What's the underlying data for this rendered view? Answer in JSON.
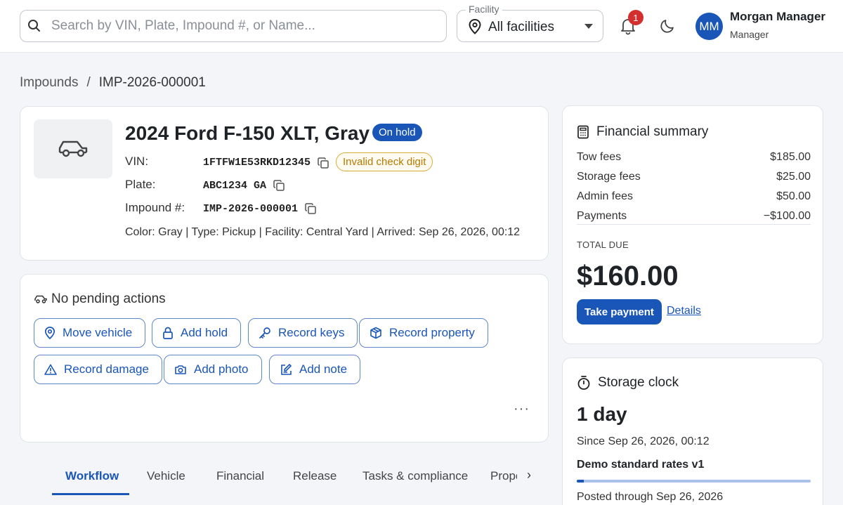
{
  "search": {
    "placeholder": "Search by VIN, Plate, Impound #, or Name..."
  },
  "facility": {
    "label": "Facility",
    "value": "All facilities"
  },
  "notifications": {
    "count": "1"
  },
  "user": {
    "initials": "MM",
    "name": "Morgan Manager",
    "role": "Manager"
  },
  "breadcrumb": {
    "root": "Impounds",
    "separator": "/",
    "current": "IMP-2026-000001"
  },
  "vehicle": {
    "title": "2024 Ford F-150 XLT, Gray",
    "status": "On hold",
    "vin_label": "VIN:",
    "vin": "1FTFW1E53RKD12345",
    "vin_warning": "Invalid check digit",
    "plate_label": "Plate:",
    "plate": "ABC1234 GA",
    "impound_label": "Impound #:",
    "impound": "IMP-2026-000001",
    "meta": "Color: Gray | Type: Pickup | Facility: Central Yard | Arrived: Sep 26, 2026, 00:12"
  },
  "actions": {
    "pending_text": "No pending actions",
    "buttons": [
      "Move vehicle",
      "Add hold",
      "Record keys",
      "Record property",
      "Record damage",
      "Add photo",
      "Add note"
    ],
    "more": "···"
  },
  "tabs": [
    "Workflow",
    "Vehicle",
    "Financial",
    "Release",
    "Tasks & compliance",
    "Prope"
  ],
  "financial": {
    "title": "Financial summary",
    "rows": [
      {
        "label": "Tow fees",
        "value": "$185.00"
      },
      {
        "label": "Storage fees",
        "value": "$25.00"
      },
      {
        "label": "Admin fees",
        "value": "$50.00"
      },
      {
        "label": "Payments",
        "value": "−$100.00"
      }
    ],
    "total_label": "TOTAL DUE",
    "total": "$160.00",
    "pay_button": "Take payment",
    "details_link": "Details"
  },
  "storage": {
    "title": "Storage clock",
    "days": "1 day",
    "since": "Since Sep 26, 2026, 00:12",
    "rate": "Demo standard rates v1",
    "progress_fraction": 0.03,
    "posted": "Posted through Sep 26, 2026"
  },
  "colors": {
    "accent": "#1a56b8",
    "badge_red": "#d32f2f",
    "warning": "#b57a00"
  }
}
